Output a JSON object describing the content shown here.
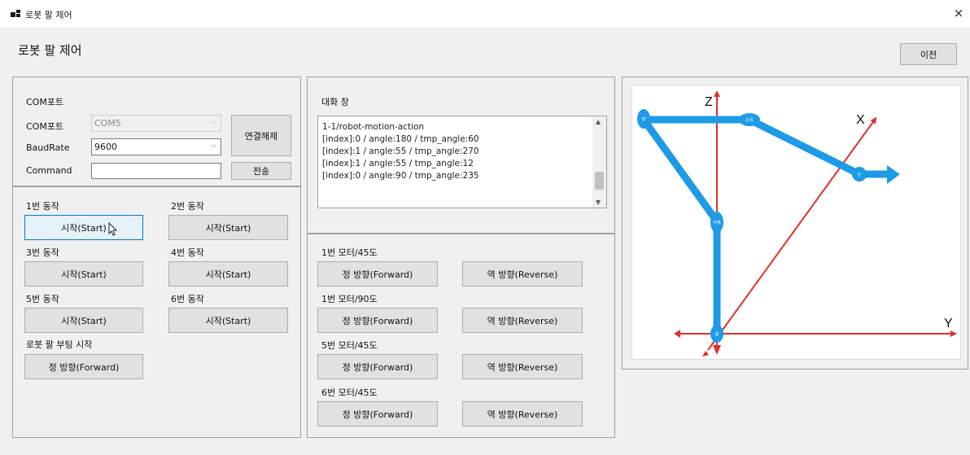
{
  "window": {
    "title": "로봇 팔 제어",
    "close_glyph": "×",
    "icon": "app-window-icon"
  },
  "header": {
    "title": "로봇 팔 제어",
    "prev_button": "이전"
  },
  "com": {
    "group_label": "COM포트",
    "port_label": "COM포트",
    "port_value": "COM5",
    "baud_label": "BaudRate",
    "baud_value": "9600",
    "command_label": "Command",
    "command_value": "",
    "disconnect_button": "연결해제",
    "send_button": "전송"
  },
  "actions": [
    {
      "label": "1번 동작",
      "button": "시작(Start)"
    },
    {
      "label": "2번 동작",
      "button": "시작(Start)"
    },
    {
      "label": "3번 동작",
      "button": "시작(Start)"
    },
    {
      "label": "4번 동작",
      "button": "시작(Start)"
    },
    {
      "label": "5번 동작",
      "button": "시작(Start)"
    },
    {
      "label": "6번 동작",
      "button": "시작(Start)"
    }
  ],
  "booting": {
    "label": "로봇 팔 부팅 시작",
    "button": "정 방향(Forward)"
  },
  "chat": {
    "label": "대화 창",
    "lines": [
      "1-1/robot-motion-action",
      "[index]:0 / angle:180 / tmp_angle:60",
      "[index]:1 / angle:55 / tmp_angle:270",
      "[index]:1 / angle:55 / tmp_angle:12",
      "[index]:0 / angle:90 / tmp_angle:235"
    ]
  },
  "motors": [
    {
      "label": "1번 모터/45도",
      "forward": "정 방향(Forward)",
      "reverse": "역 방향(Reverse)"
    },
    {
      "label": "1번 모터/90도",
      "forward": "정 방향(Forward)",
      "reverse": "역 방향(Reverse)"
    },
    {
      "label": "5번 모터/45도",
      "forward": "정 방향(Forward)",
      "reverse": "역 방향(Reverse)"
    },
    {
      "label": "6번 모터/45도",
      "forward": "정 방향(Forward)",
      "reverse": "역 방향(Reverse)"
    }
  ],
  "diagram": {
    "axis_z": "Z",
    "axis_x": "X",
    "axis_y": "Y",
    "joint_labels": [
      "팔",
      "손목",
      "어깨",
      "몸",
      "손"
    ],
    "colors": {
      "arm": "#1e9be6",
      "axis": "#e0302a",
      "joint": "#1e9be6"
    }
  }
}
